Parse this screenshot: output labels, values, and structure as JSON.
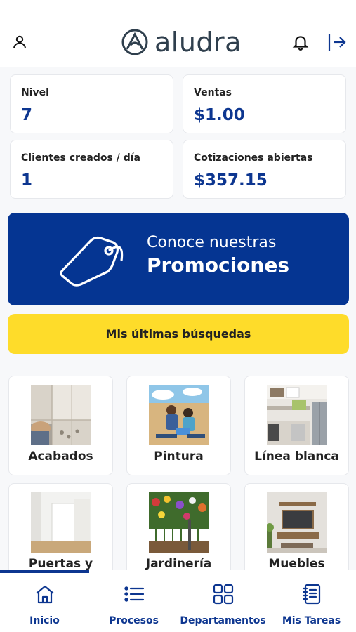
{
  "header": {
    "logo_text": "aludra",
    "icons": [
      "user-icon",
      "bell-icon",
      "logout-icon"
    ]
  },
  "stats": [
    {
      "label": "Nivel",
      "value": "7"
    },
    {
      "label": "Ventas",
      "value": "$1.00"
    },
    {
      "label": "Clientes creados / día",
      "value": "1"
    },
    {
      "label": "Cotizaciones abiertas",
      "value": "$357.15"
    }
  ],
  "promo": {
    "line1": "Conoce nuestras",
    "line2": "Promociones"
  },
  "recent_searches_label": "Mis últimas búsquedas",
  "categories": [
    {
      "label": "Acabados"
    },
    {
      "label": "Pintura"
    },
    {
      "label": "Línea blanca"
    },
    {
      "label": "Puertas y"
    },
    {
      "label": "Jardinería"
    },
    {
      "label": "Muebles"
    }
  ],
  "tabs": [
    {
      "label": "Inicio",
      "icon": "home-icon",
      "active": true
    },
    {
      "label": "Procesos",
      "icon": "list-icon",
      "active": false
    },
    {
      "label": "Departamentos",
      "icon": "grid-icon",
      "active": false
    },
    {
      "label": "Mis Tareas",
      "icon": "notebook-icon",
      "active": false
    }
  ],
  "colors": {
    "brand_blue": "#053592",
    "accent_yellow": "#fedc2a",
    "text_blue": "#0d3690"
  }
}
